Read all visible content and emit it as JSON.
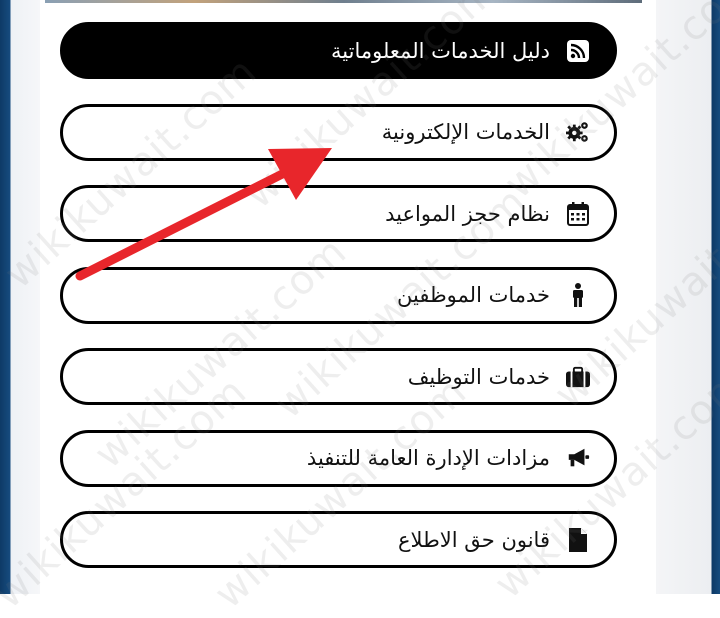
{
  "menu": {
    "items": [
      {
        "label": "دليل الخدمات المعلوماتية",
        "icon": "rss-icon",
        "active": true
      },
      {
        "label": "الخدمات الإلكترونية",
        "icon": "gears-icon",
        "active": false
      },
      {
        "label": "نظام حجز المواعيد",
        "icon": "calendar-icon",
        "active": false
      },
      {
        "label": "خدمات الموظفين",
        "icon": "person-icon",
        "active": false
      },
      {
        "label": "خدمات التوظيف",
        "icon": "briefcase-icon",
        "active": false
      },
      {
        "label": "مزادات الإدارة العامة للتنفيذ",
        "icon": "megaphone-icon",
        "active": false
      },
      {
        "label": "قانون حق الاطلاع",
        "icon": "document-icon",
        "active": false
      }
    ]
  },
  "watermark": {
    "text": "wikikuwait.com"
  },
  "colors": {
    "active_bg": "#000000",
    "border": "#000000",
    "arrow": "#e8262b",
    "frame": "#164b7e"
  }
}
